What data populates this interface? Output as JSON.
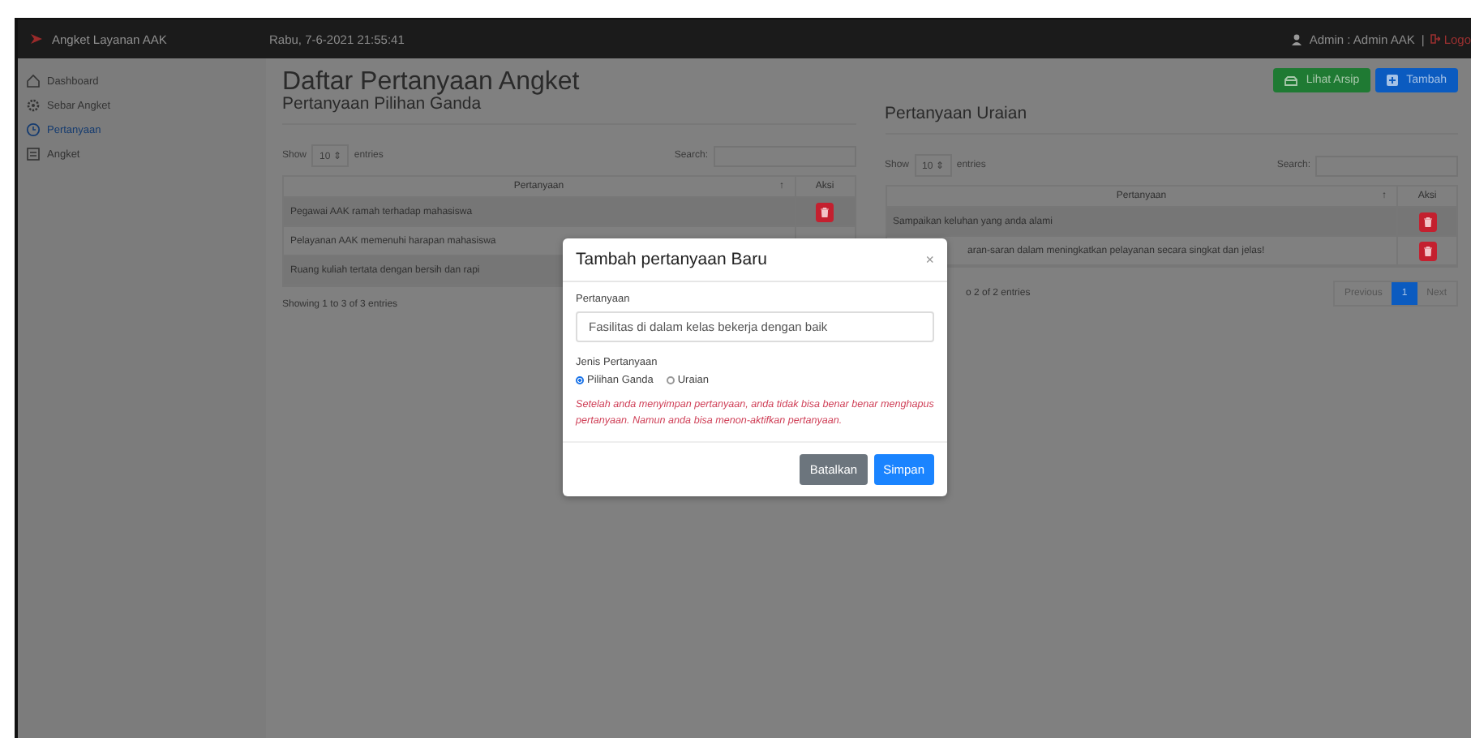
{
  "navbar": {
    "brand": "Angket Layanan AAK",
    "datetime": "Rabu, 7-6-2021 21:55:41",
    "user": "Admin : Admin AAK",
    "separator": "|",
    "logout": "Logo"
  },
  "sidebar": {
    "items": [
      {
        "label": "Dashboard",
        "kind": "home",
        "selected": false
      },
      {
        "label": "Sebar Angket",
        "kind": "gear",
        "selected": false
      },
      {
        "label": "Pertanyaan",
        "kind": "clock",
        "selected": true
      },
      {
        "label": "Angket",
        "kind": "list",
        "selected": false
      }
    ]
  },
  "page": {
    "title": "Daftar Pertanyaan Angket",
    "buttons": [
      {
        "label": "Lihat Arsip",
        "kind": "archive"
      },
      {
        "label": "Tambah",
        "kind": "add"
      }
    ]
  },
  "tables": [
    {
      "heading": "Pertanyaan Pilihan Ganda",
      "show_label": "Show",
      "page_size": "10",
      "select_arrows": "⇕",
      "entries_label": "entries",
      "search_label": "Search:",
      "columns": [
        {
          "label": "Pertanyaan",
          "sort": "↑"
        },
        {
          "label": "Aksi"
        }
      ],
      "rows": [
        {
          "text": "Pegawai AAK ramah terhadap mahasiswa",
          "kind": "deletable",
          "covered": false
        },
        {
          "text": "Pelayanan AAK memenuhi harapan mahasiswa",
          "kind": "plain",
          "covered": false
        },
        {
          "text": "Ruang kuliah tertata dengan bersih dan rapi",
          "kind": "plain",
          "covered": false
        }
      ],
      "info": "Showing 1 to 3 of 3 entries",
      "info_covered": false
    },
    {
      "heading": "Pertanyaan Uraian",
      "show_label": "Show",
      "page_size": "10",
      "select_arrows": "⇕",
      "entries_label": "entries",
      "search_label": "Search:",
      "columns": [
        {
          "label": "Pertanyaan",
          "sort": "↑"
        },
        {
          "label": "Aksi"
        }
      ],
      "rows": [
        {
          "text": "Sampaikan keluhan yang anda alami",
          "kind": "deletable",
          "covered": false
        },
        {
          "text": "aran-saran dalam meningkatkan pelayanan secara singkat dan jelas!",
          "kind": "deletable",
          "covered": true
        }
      ],
      "info": "o 2 of 2 entries",
      "info_covered": true,
      "pagination": [
        {
          "label": "Previous",
          "selected": false
        },
        {
          "label": "1",
          "selected": true
        },
        {
          "label": "Next",
          "selected": false
        }
      ]
    }
  ],
  "modal": {
    "title": "Tambah pertanyaan Baru",
    "close": "×",
    "field_label": "Pertanyaan",
    "field_value": "Fasilitas di dalam kelas bekerja dengan baik",
    "type_label": "Jenis Pertanyaan",
    "options": [
      {
        "label": "Pilihan Ganda",
        "selected": true
      },
      {
        "label": "Uraian",
        "selected": false
      }
    ],
    "warning": "Setelah anda menyimpan pertanyaan, anda tidak bisa benar benar menghapus pertanyaan. Namun anda bisa menon-aktifkan pertanyaan.",
    "buttons": [
      {
        "label": "Batalkan",
        "kind": "cancel"
      },
      {
        "label": "Simpan",
        "kind": "primary"
      }
    ]
  }
}
